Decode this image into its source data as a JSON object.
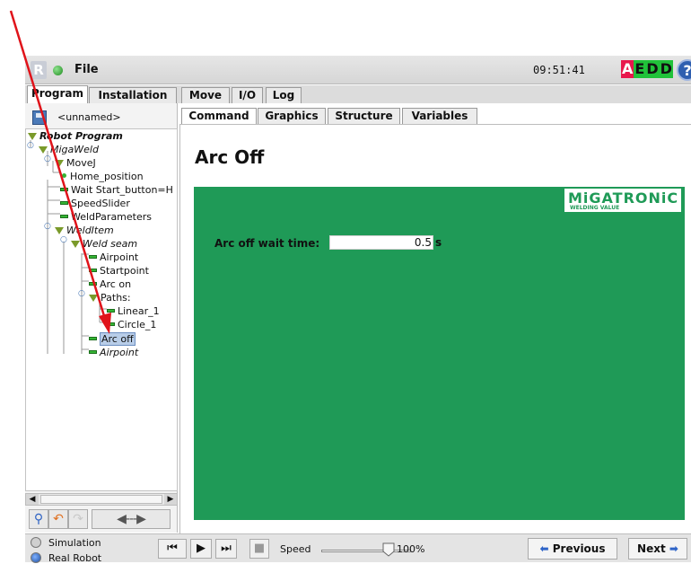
{
  "titlebar": {
    "logo_letter": "R",
    "file_menu": "File",
    "clock": "09:51:41",
    "safety_badge": [
      "A",
      "E",
      "D",
      "D"
    ],
    "help_symbol": "?"
  },
  "main_tabs": [
    {
      "label": "Program",
      "active": true
    },
    {
      "label": "Installation",
      "active": false
    },
    {
      "label": "Move",
      "active": false
    },
    {
      "label": "I/O",
      "active": false
    },
    {
      "label": "Log",
      "active": false
    }
  ],
  "program": {
    "name": "<unnamed>"
  },
  "tree": [
    {
      "label": "Robot Program",
      "style": "bold"
    },
    {
      "label": "MigaWeld",
      "style": "italic"
    },
    {
      "label": "MoveJ",
      "style": "normal"
    },
    {
      "label": "Home_position",
      "style": "normal"
    },
    {
      "label": "Wait Start_button=H",
      "style": "normal"
    },
    {
      "label": "SpeedSlider",
      "style": "normal"
    },
    {
      "label": "WeldParameters",
      "style": "normal"
    },
    {
      "label": "WeldItem",
      "style": "italic"
    },
    {
      "label": "Weld seam",
      "style": "italic"
    },
    {
      "label": "Airpoint",
      "style": "normal"
    },
    {
      "label": "Startpoint",
      "style": "normal"
    },
    {
      "label": "Arc on",
      "style": "normal"
    },
    {
      "label": "Paths:",
      "style": "normal"
    },
    {
      "label": "Linear_1",
      "style": "normal"
    },
    {
      "label": "Circle_1",
      "style": "normal"
    },
    {
      "label": "Arc off",
      "style": "selected"
    },
    {
      "label": "Airpoint",
      "style": "italic"
    }
  ],
  "tree_toolbar": {
    "move_arrows": "◀---▶"
  },
  "content_tabs": [
    {
      "label": "Command",
      "active": true
    },
    {
      "label": "Graphics",
      "active": false
    },
    {
      "label": "Structure",
      "active": false
    },
    {
      "label": "Variables",
      "active": false
    }
  ],
  "command": {
    "title": "Arc Off",
    "brand_name": "MiGATRONiC",
    "brand_tagline": "WELDING VALUE",
    "wait_label": "Arc off wait time:",
    "wait_value": "0.5",
    "wait_unit": "s"
  },
  "bottombar": {
    "mode_simulation": "Simulation",
    "mode_real": "Real Robot",
    "speed_label": "Speed",
    "speed_value": "100%",
    "speed_fraction": 1.0,
    "previous": "Previous",
    "next": "Next"
  },
  "colors": {
    "panel_green": "#1f9a57",
    "annotation_red": "#e0131a",
    "safety_a": "#e8174c",
    "safety_edd": "#21c23a"
  }
}
